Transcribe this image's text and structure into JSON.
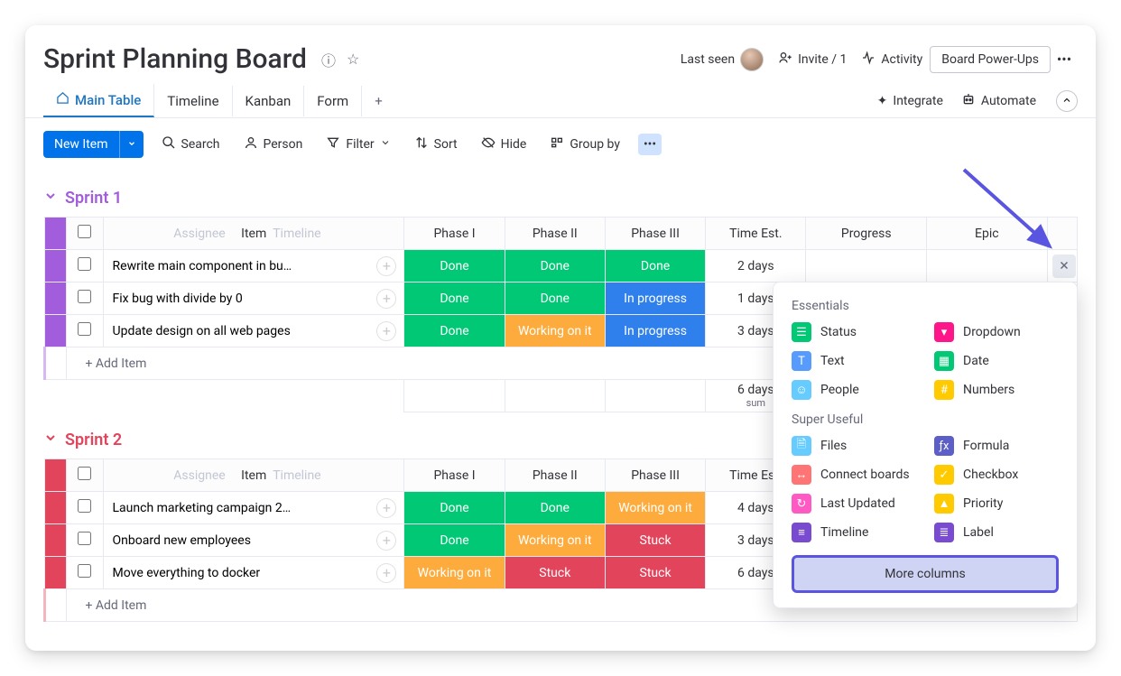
{
  "header": {
    "title": "Sprint Planning Board",
    "last_seen": "Last seen",
    "invite": "Invite / 1",
    "activity": "Activity",
    "powerups": "Board Power-Ups"
  },
  "tabs": {
    "main": "Main Table",
    "timeline": "Timeline",
    "kanban": "Kanban",
    "form": "Form",
    "integrate": "Integrate",
    "automate": "Automate"
  },
  "toolbar": {
    "new_item": "New Item",
    "search": "Search",
    "person": "Person",
    "filter": "Filter",
    "sort": "Sort",
    "hide": "Hide",
    "group_by": "Group by"
  },
  "columns": {
    "assignee": "Assignee",
    "item": "Item",
    "timeline": "Timeline",
    "phase1": "Phase I",
    "phase2": "Phase II",
    "phase3": "Phase III",
    "time_est": "Time Est.",
    "progress": "Progress",
    "epic": "Epic"
  },
  "status": {
    "done": "Done",
    "working": "Working on it",
    "progress": "In progress",
    "stuck": "Stuck"
  },
  "groups": [
    {
      "name": "Sprint 1",
      "color": "purple",
      "rows": [
        {
          "item": "Rewrite main component in bu…",
          "p1": "done",
          "p2": "done",
          "p3": "done",
          "time": "2 days"
        },
        {
          "item": "Fix bug with divide by 0",
          "p1": "done",
          "p2": "done",
          "p3": "progress",
          "time": "1 days"
        },
        {
          "item": "Update design on all web pages",
          "p1": "done",
          "p2": "working",
          "p3": "progress",
          "time": "3 days"
        }
      ],
      "sum": {
        "value": "6 days",
        "label": "sum"
      }
    },
    {
      "name": "Sprint 2",
      "color": "red",
      "rows": [
        {
          "item": "Launch marketing campaign 2…",
          "p1": "done",
          "p2": "done",
          "p3": "working",
          "time": "4 days"
        },
        {
          "item": "Onboard new employees",
          "p1": "done",
          "p2": "working",
          "p3": "stuck",
          "time": "3 days"
        },
        {
          "item": "Move everything to docker",
          "p1": "working",
          "p2": "stuck",
          "p3": "stuck",
          "time": "6 days"
        }
      ]
    }
  ],
  "add_item": "+ Add Item",
  "popup": {
    "essentials_title": "Essentials",
    "super_title": "Super Useful",
    "essentials": [
      {
        "label": "Status",
        "color": "#00c875",
        "glyph": "☰"
      },
      {
        "label": "Dropdown",
        "color": "#ff158a",
        "glyph": "▾"
      },
      {
        "label": "Text",
        "color": "#579bfc",
        "glyph": "T"
      },
      {
        "label": "Date",
        "color": "#00c875",
        "glyph": "▦"
      },
      {
        "label": "People",
        "color": "#66ccff",
        "glyph": "☺"
      },
      {
        "label": "Numbers",
        "color": "#ffcb00",
        "glyph": "#"
      }
    ],
    "super": [
      {
        "label": "Files",
        "color": "#66ccff",
        "glyph": "🗎"
      },
      {
        "label": "Formula",
        "color": "#5b5fc7",
        "glyph": "ƒx"
      },
      {
        "label": "Connect boards",
        "color": "#ff7575",
        "glyph": "↔"
      },
      {
        "label": "Checkbox",
        "color": "#ffcb00",
        "glyph": "✓"
      },
      {
        "label": "Last Updated",
        "color": "#ff5ac4",
        "glyph": "↻"
      },
      {
        "label": "Priority",
        "color": "#ffcb00",
        "glyph": "▲"
      },
      {
        "label": "Timeline",
        "color": "#784bd1",
        "glyph": "≡"
      },
      {
        "label": "Label",
        "color": "#784bd1",
        "glyph": "≣"
      }
    ],
    "more": "More columns"
  }
}
